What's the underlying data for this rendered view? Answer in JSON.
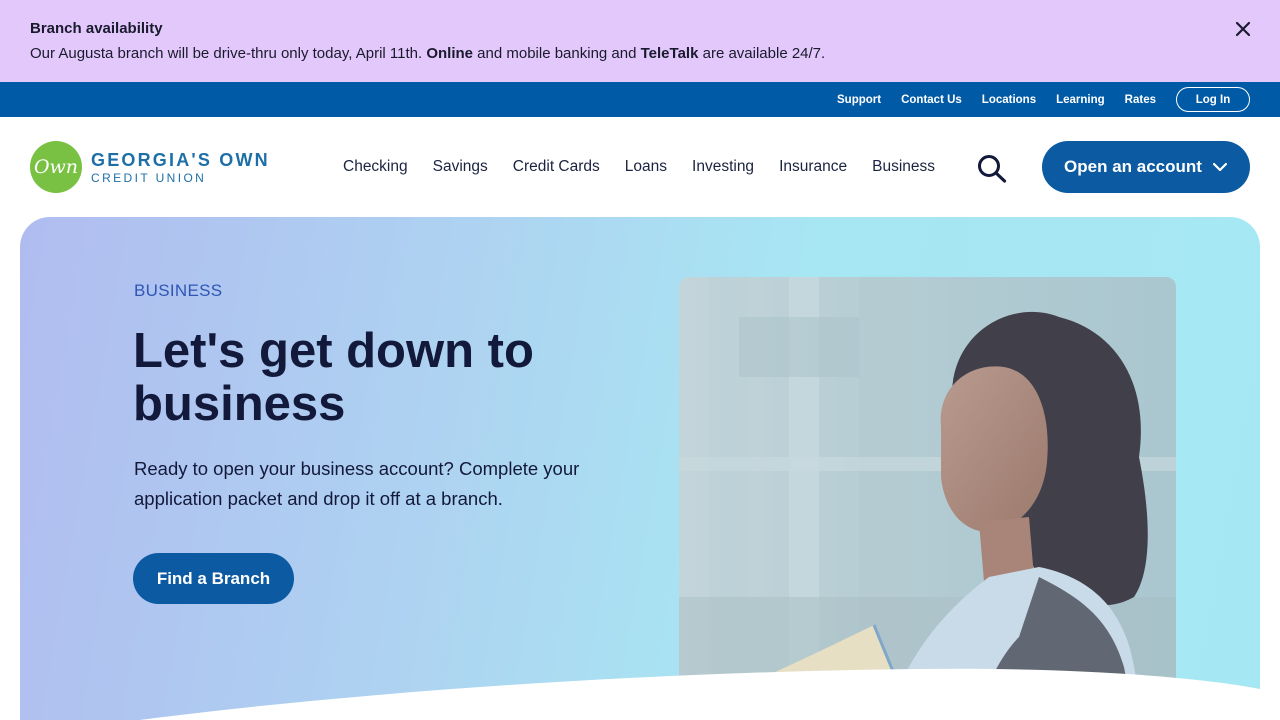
{
  "alert": {
    "title": "Branch availability",
    "message_parts": {
      "p1": "Our Augusta branch will be drive-thru only today, April 11th. ",
      "b1": "Online",
      "p2": " and mobile banking and ",
      "b2": "TeleTalk",
      "p3": " are available 24/7."
    },
    "close_icon": "close-icon",
    "background": "#e3c8fb"
  },
  "utility": {
    "links": [
      "Support",
      "Contact Us",
      "Locations",
      "Learning",
      "Rates"
    ],
    "login_label": "Log In",
    "background": "#005aa6"
  },
  "logo": {
    "mark": "Own",
    "name": "GEORGIA'S OWN",
    "sub": "CREDIT UNION",
    "mark_color": "#79c143",
    "text_color": "#1e6fa8"
  },
  "nav": {
    "items": [
      "Checking",
      "Savings",
      "Credit Cards",
      "Loans",
      "Investing",
      "Insurance",
      "Business"
    ],
    "search_icon": "search-icon",
    "open_account_label": "Open an account",
    "open_account_icon": "chevron-down-icon"
  },
  "hero": {
    "eyebrow": "BUSINESS",
    "headline": "Let's get down to business",
    "subcopy": "Ready to open your business account? Complete your application packet and drop it off at a branch.",
    "cta_label": "Find a Branch",
    "accent": "#0b5aa2"
  }
}
